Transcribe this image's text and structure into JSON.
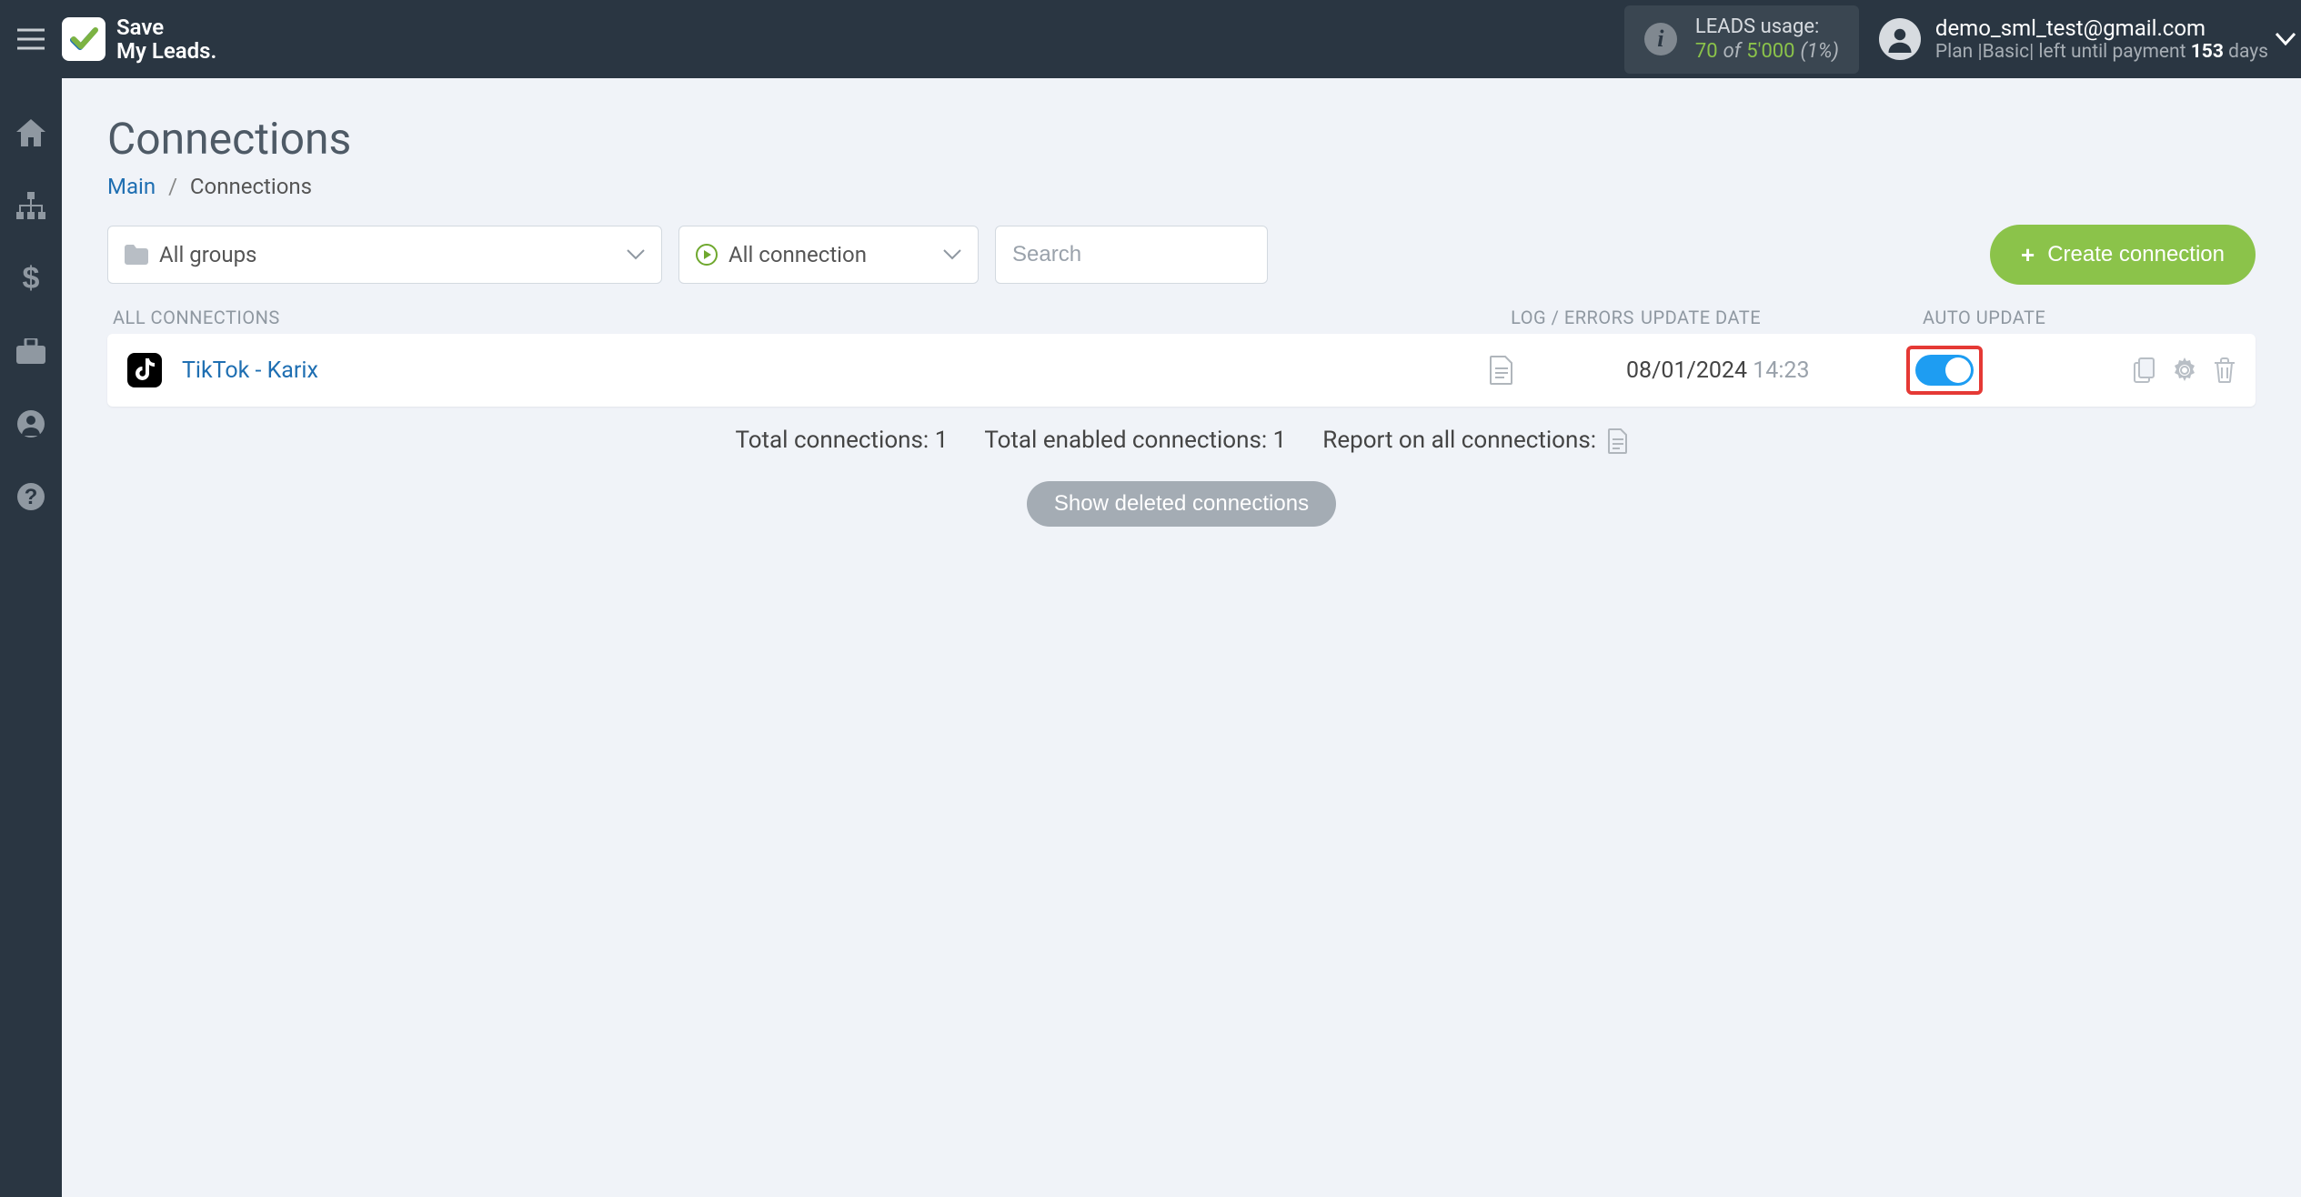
{
  "brand": {
    "line1": "Save",
    "line2": "My Leads."
  },
  "leads_usage": {
    "label": "LEADS usage:",
    "used": "70",
    "of_word": "of",
    "total": "5'000",
    "pct": "(1%)"
  },
  "account": {
    "email": "demo_sml_test@gmail.com",
    "plan_prefix": "Plan |",
    "plan_name": "Basic",
    "plan_mid": "| left until payment ",
    "days": "153",
    "days_word": " days"
  },
  "page": {
    "title": "Connections",
    "breadcrumb_main": "Main",
    "breadcrumb_current": "Connections",
    "btn_create": "Create connection",
    "show_deleted": "Show deleted connections"
  },
  "filters": {
    "groups_label": "All groups",
    "conn_label": "All connection",
    "search_placeholder": "Search"
  },
  "headers": {
    "name": "ALL CONNECTIONS",
    "log": "LOG / ERRORS",
    "date": "UPDATE DATE",
    "auto": "AUTO UPDATE"
  },
  "rows": [
    {
      "name": "TikTok - Karix",
      "date": "08/01/2024",
      "time": "14:23",
      "auto_on": true
    }
  ],
  "summary": {
    "total_conn_label": "Total connections: ",
    "total_conn_val": "1",
    "total_enabled_label": "Total enabled connections: ",
    "total_enabled_val": "1",
    "report_label": "Report on all connections: "
  }
}
